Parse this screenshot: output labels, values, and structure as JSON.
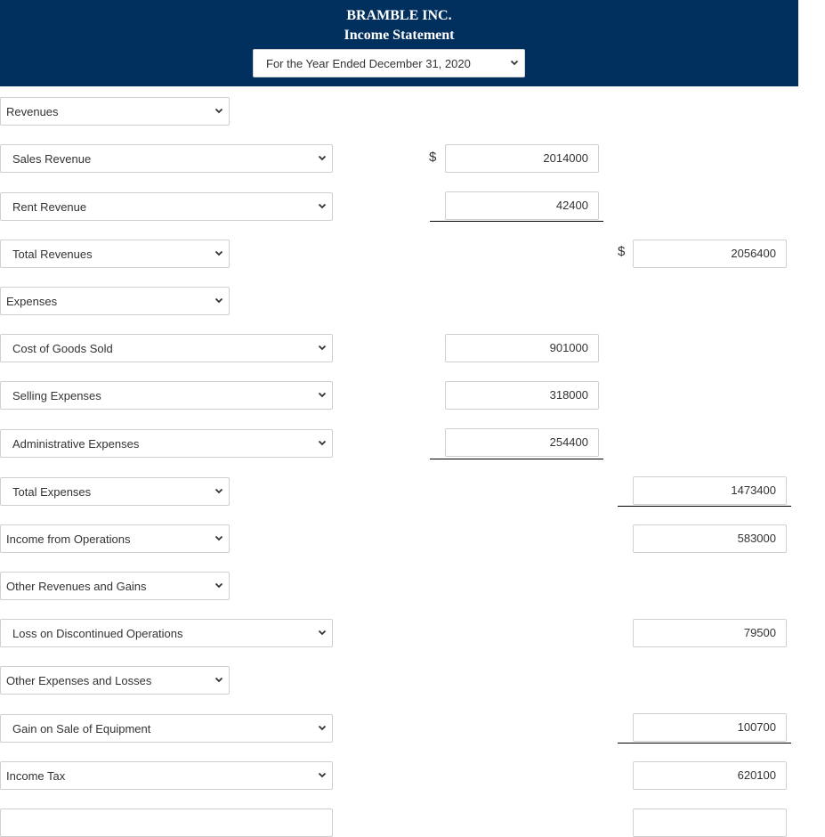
{
  "header": {
    "company": "BRAMBLE INC.",
    "title": "Income Statement",
    "period": "For the Year Ended December 31, 2020",
    "background_color": "#02305e"
  },
  "rows": [
    {
      "label": "Revenues"
    },
    {
      "label": "Sales Revenue",
      "col1": "2014000",
      "col1_currency": "$"
    },
    {
      "label": "Rent Revenue",
      "col1": "42400"
    },
    {
      "label": "Total Revenues",
      "col2": "2056400",
      "col2_currency": "$"
    },
    {
      "label": "Expenses"
    },
    {
      "label": "Cost of Goods Sold",
      "col1": "901000"
    },
    {
      "label": "Selling Expenses",
      "col1": "318000"
    },
    {
      "label": "Administrative Expenses",
      "col1": "254400"
    },
    {
      "label": "Total Expenses",
      "col2": "1473400"
    },
    {
      "label": "Income from Operations",
      "col2": "583000"
    },
    {
      "label": "Other Revenues and Gains"
    },
    {
      "label": "Loss on Discontinued Operations",
      "col2": "79500"
    },
    {
      "label": "Other Expenses and Losses"
    },
    {
      "label": "Gain on Sale of Equipment",
      "col2": "100700"
    },
    {
      "label": "Income Tax",
      "col2": "620100"
    },
    {
      "label": "",
      "col2": ""
    }
  ],
  "icons": {
    "dropdown": "chevron-down-icon"
  }
}
